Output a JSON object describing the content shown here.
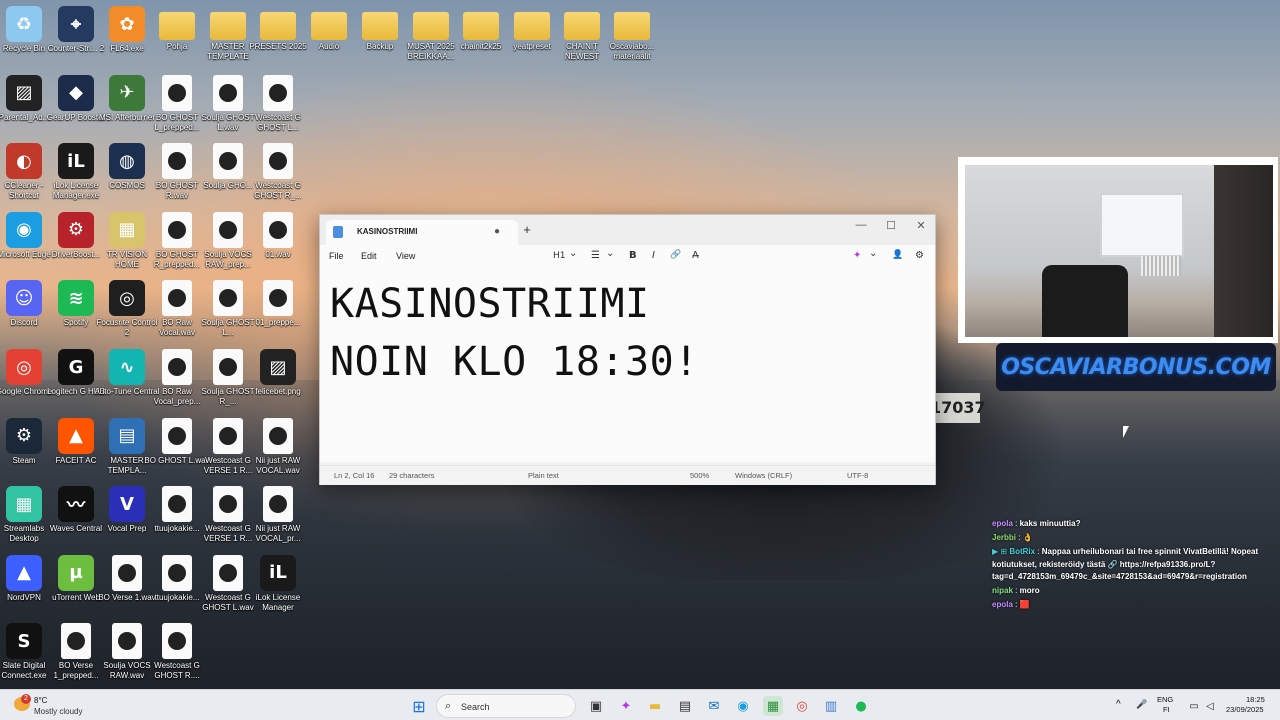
{
  "desktop": {
    "icons": [
      {
        "id": "recycle",
        "label": "Recycle Bin",
        "icon": "recycle-bin-icon"
      },
      {
        "id": "cs2",
        "label": "Counter-Stri... 2",
        "icon": "counter-strike-icon"
      },
      {
        "id": "fl64",
        "label": "FL64.exe",
        "icon": "fl-studio-icon"
      },
      {
        "id": "pohja",
        "label": "Pohja",
        "icon": "folder-icon"
      },
      {
        "id": "master",
        "label": "MASTER TEMPLATE",
        "icon": "folder-icon"
      },
      {
        "id": "presets",
        "label": "PRESETS 2025",
        "icon": "folder-icon"
      },
      {
        "id": "audio",
        "label": "Audio",
        "icon": "folder-icon"
      },
      {
        "id": "backup",
        "label": "Backup",
        "icon": "folder-icon"
      },
      {
        "id": "musat",
        "label": "MUSAT 2025 BREIKKAA...",
        "icon": "folder-icon"
      },
      {
        "id": "chainit",
        "label": "chainit2k25",
        "icon": "folder-icon"
      },
      {
        "id": "yeat",
        "label": "yeatpreset",
        "icon": "folder-icon"
      },
      {
        "id": "chainitnewest",
        "label": "CHAINIT NEWEST",
        "icon": "folder-icon"
      },
      {
        "id": "oscavia",
        "label": "Oscaviabo... materiaalit",
        "icon": "folder-icon"
      },
      {
        "id": "parental",
        "label": "Parental_Ad...",
        "icon": "image-icon"
      },
      {
        "id": "gearup",
        "label": "GearUP Booster",
        "icon": "gearup-icon"
      },
      {
        "id": "msi",
        "label": "MSI Afterburner",
        "icon": "msi-afterburner-icon"
      },
      {
        "id": "bo1",
        "label": "BO GHOST L_prepped...",
        "icon": "audio-file-icon"
      },
      {
        "id": "soulja1",
        "label": "Soulja GHOST L.wav",
        "icon": "audio-file-icon"
      },
      {
        "id": "westcoast1",
        "label": "Westcoast G GHOST L...",
        "icon": "audio-file-icon"
      },
      {
        "id": "ccleaner",
        "label": "CCleaner - Shortcut",
        "icon": "ccleaner-icon"
      },
      {
        "id": "ilok",
        "label": "iLok License Manager.exe",
        "icon": "ilok-icon"
      },
      {
        "id": "cosmos",
        "label": "COSMOS",
        "icon": "cosmos-icon"
      },
      {
        "id": "bo2",
        "label": "BO GHOST R.wav",
        "icon": "audio-file-icon"
      },
      {
        "id": "soulja2",
        "label": "Soulja GHO...",
        "icon": "audio-file-icon"
      },
      {
        "id": "westcoast2",
        "label": "Westcoast G GHOST R_...",
        "icon": "audio-file-icon"
      },
      {
        "id": "edge",
        "label": "Microsoft Edge",
        "icon": "edge-icon"
      },
      {
        "id": "driverbooster",
        "label": "DriverBoost...",
        "icon": "driver-booster-icon"
      },
      {
        "id": "trvision",
        "label": "TR VISION HOME",
        "icon": "tr-vision-icon"
      },
      {
        "id": "bo3",
        "label": "BO GHOST R_prepped...",
        "icon": "audio-file-icon"
      },
      {
        "id": "soulja3",
        "label": "Soulja VOCS RAW_prep...",
        "icon": "audio-file-icon"
      },
      {
        "id": "o1",
        "label": "01.wav",
        "icon": "audio-file-icon"
      },
      {
        "id": "discord",
        "label": "Discord",
        "icon": "discord-icon"
      },
      {
        "id": "spotify",
        "label": "Spotify",
        "icon": "spotify-icon"
      },
      {
        "id": "focusrite",
        "label": "Focusrite Control 2",
        "icon": "focusrite-icon"
      },
      {
        "id": "boraw",
        "label": "BO Raw Vocal.wav",
        "icon": "audio-file-icon"
      },
      {
        "id": "soulja4",
        "label": "Soulja GHOST L...",
        "icon": "audio-file-icon"
      },
      {
        "id": "o1prep",
        "label": "01_preppe...",
        "icon": "audio-file-icon"
      },
      {
        "id": "chrome",
        "label": "Google Chrome",
        "icon": "chrome-icon"
      },
      {
        "id": "logitech",
        "label": "Logitech G HUB",
        "icon": "logitech-icon"
      },
      {
        "id": "autotune",
        "label": "Auto-Tune Central",
        "icon": "autotune-icon"
      },
      {
        "id": "borawprep",
        "label": "BO Raw Vocal_prep...",
        "icon": "audio-file-icon"
      },
      {
        "id": "soulja5",
        "label": "Soulja GHOST R_...",
        "icon": "audio-file-icon"
      },
      {
        "id": "felicebet",
        "label": "felicebet.png",
        "icon": "image-icon"
      },
      {
        "id": "steam",
        "label": "Steam",
        "icon": "steam-icon"
      },
      {
        "id": "faceit",
        "label": "FACEIT AC",
        "icon": "faceit-icon"
      },
      {
        "id": "mastertemp",
        "label": "MASTER TEMPLA...",
        "icon": "document-icon"
      },
      {
        "id": "bo4",
        "label": "BO GHOST L.wav",
        "icon": "audio-file-icon"
      },
      {
        "id": "westcoast3",
        "label": "Westcoast G VERSE 1 R...",
        "icon": "audio-file-icon"
      },
      {
        "id": "niijust1",
        "label": "Nii just RAW VOCAL.wav",
        "icon": "audio-file-icon"
      },
      {
        "id": "streamlabs",
        "label": "Streamlabs Desktop",
        "icon": "streamlabs-icon"
      },
      {
        "id": "waves",
        "label": "Waves Central",
        "icon": "waves-icon"
      },
      {
        "id": "vocalprep",
        "label": "Vocal Prep",
        "icon": "vocal-prep-icon"
      },
      {
        "id": "ttuu1",
        "label": "ttuujokakie...",
        "icon": "audio-file-icon"
      },
      {
        "id": "westcoast4",
        "label": "Westcoast G VERSE 1 R...",
        "icon": "audio-file-icon"
      },
      {
        "id": "niijust2",
        "label": "Nii just RAW VOCAL_pr...",
        "icon": "audio-file-icon"
      },
      {
        "id": "nordvpn",
        "label": "NordVPN",
        "icon": "nordvpn-icon"
      },
      {
        "id": "utorrent",
        "label": "uTorrent Web",
        "icon": "utorrent-icon"
      },
      {
        "id": "boverse1",
        "label": "BO Verse 1.wav",
        "icon": "audio-file-icon"
      },
      {
        "id": "ttuu2",
        "label": "ttuujokakie...",
        "icon": "audio-file-icon"
      },
      {
        "id": "westcoast5",
        "label": "Westcoast G GHOST L.wav",
        "icon": "audio-file-icon"
      },
      {
        "id": "ilok2",
        "label": "iLok License Manager",
        "icon": "ilok-icon"
      },
      {
        "id": "slate",
        "label": "Slate Digital Connect.exe",
        "icon": "slate-digital-icon"
      },
      {
        "id": "boverse2",
        "label": "BO Verse 1_prepped...",
        "icon": "audio-file-icon"
      },
      {
        "id": "soulja6",
        "label": "Soulja VOCS RAW.wav",
        "icon": "audio-file-icon"
      },
      {
        "id": "westcoast6",
        "label": "Westcoast G GHOST R....",
        "icon": "audio-file-icon"
      }
    ]
  },
  "notepad": {
    "tab_title": "KASINOSTRIIMI",
    "tab_dirty": "●",
    "new_tab": "+",
    "minimize": "—",
    "maximize": "☐",
    "close": "✕",
    "menu": {
      "file": "File",
      "edit": "Edit",
      "view": "View"
    },
    "toolbar": {
      "heading": "H1",
      "heading_chevron": "⌄",
      "list": "☰",
      "list_chevron": "⌄",
      "bold": "B",
      "italic": "I",
      "link": "🔗",
      "clear_format": "A̶",
      "copilot": "✦",
      "copilot_chevron": "⌄",
      "account": "👤",
      "settings": "⚙"
    },
    "lines": [
      "KASINOSTRIIMI",
      "NOIN KLO 18:30!"
    ],
    "status": {
      "position": "Ln 2, Col 16",
      "characters": "29 characters",
      "format": "Plain text",
      "zoom": "500%",
      "line_endings": "Windows (CRLF)",
      "encoding": "UTF-8"
    }
  },
  "stream": {
    "banner_text": "OSCAVIARBONUS.COM",
    "plate": "17037",
    "chat": [
      {
        "user": "epola",
        "user_color": "#c78bff",
        "msg": "kaks minuuttia?"
      },
      {
        "user": "Jerbbi",
        "user_color": "#8cd96a",
        "msg": "👌"
      },
      {
        "user": "BotRix",
        "user_color": "#3fd0d8",
        "prefix": "▶ ⊞",
        "msg": "Nappaa urheilubonari tai free spinnit VivatBetillä! Nopeat kotiutukset, rekisteröidy tästä 🔗 https://refpa91336.pro/L?tag=d_4728153m_69479c_&site=4728153&ad=69479&r=registration"
      },
      {
        "user": "nipak",
        "user_color": "#7fe08a",
        "msg": "moro"
      },
      {
        "user": "epola",
        "user_color": "#c78bff",
        "msg": "🟥"
      }
    ]
  },
  "taskbar": {
    "weather_badge": "2",
    "weather_temp": "8°C",
    "weather_desc": "Mostly cloudy",
    "search_placeholder": "Search",
    "apps": [
      "windows-start-icon",
      "search",
      "copilot-icon",
      "task-view-icon",
      "copilot-app-icon",
      "file-explorer-icon",
      "terminal-icon",
      "outlook-icon",
      "edge-icon",
      "streamlabs-icon",
      "chrome-icon",
      "notepad-icon",
      "spotify-icon"
    ],
    "tray": {
      "chevron": "^",
      "mic": "🎤",
      "lang": "ENG",
      "region": "FI",
      "time": "18:25",
      "date": "23/09/2025"
    }
  }
}
